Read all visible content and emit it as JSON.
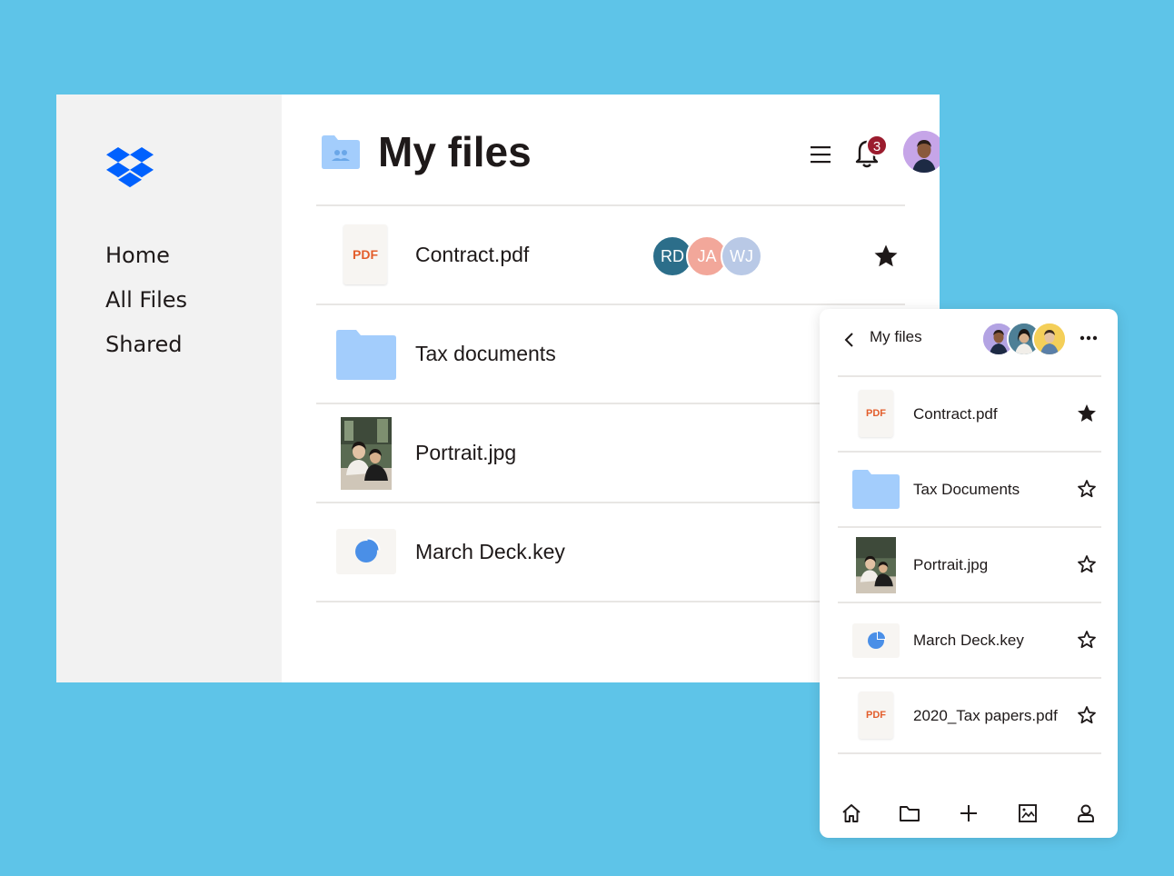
{
  "colors": {
    "background": "#5ec4e8",
    "sidebar": "#f2f2f2",
    "brand_blue": "#0061fe",
    "folder_blue": "#a3cdfc",
    "pdf_orange": "#e35d2b",
    "badge_red": "#9b1c2e"
  },
  "sidebar": {
    "logo_icon": "dropbox-logo",
    "items": [
      {
        "label": "Home"
      },
      {
        "label": "All Files"
      },
      {
        "label": "Shared"
      }
    ]
  },
  "header": {
    "title": "My files",
    "folder_icon": "shared-folder-icon",
    "menu_icon": "hamburger-icon",
    "bell_icon": "bell-icon",
    "notification_count": "3",
    "avatar_icon": "user-avatar"
  },
  "files": [
    {
      "name": "Contract.pdf",
      "type": "pdf",
      "badge": "PDF",
      "starred": true,
      "collaborators": [
        {
          "initials": "RD",
          "color": "#2c6e8a"
        },
        {
          "initials": "JA",
          "color": "#f2a79a"
        },
        {
          "initials": "WJ",
          "color": "#b9c9e6"
        }
      ]
    },
    {
      "name": "Tax documents",
      "type": "folder"
    },
    {
      "name": "Portrait.jpg",
      "type": "image"
    },
    {
      "name": "March Deck.key",
      "type": "keynote"
    }
  ],
  "mobile": {
    "back_icon": "chevron-left-icon",
    "title": "My files",
    "more_icon": "more-horizontal-icon",
    "members": [
      "avatar-1",
      "avatar-2",
      "avatar-3"
    ],
    "files": [
      {
        "name": "Contract.pdf",
        "type": "pdf",
        "badge": "PDF",
        "starred": true
      },
      {
        "name": "Tax Documents",
        "type": "folder",
        "starred": false
      },
      {
        "name": "Portrait.jpg",
        "type": "image",
        "starred": false
      },
      {
        "name": "March Deck.key",
        "type": "keynote",
        "starred": false
      },
      {
        "name": "2020_Tax papers.pdf",
        "type": "pdf",
        "badge": "PDF",
        "starred": false
      }
    ],
    "tabs": [
      "home-icon",
      "folder-icon",
      "plus-icon",
      "photos-icon",
      "account-icon"
    ]
  }
}
